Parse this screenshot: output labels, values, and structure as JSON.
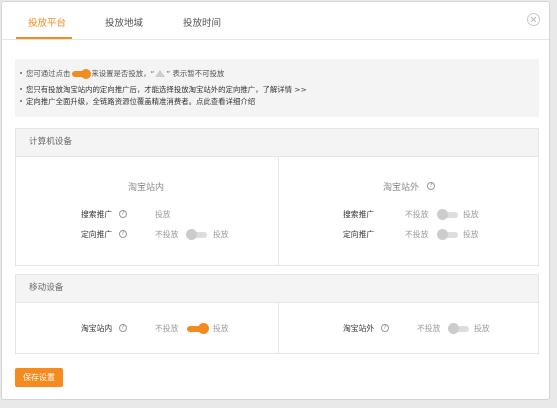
{
  "tabs": [
    {
      "label": "投放平台",
      "active": true
    },
    {
      "label": "投放地域",
      "active": false
    },
    {
      "label": "投放时间",
      "active": false
    }
  ],
  "notice": {
    "line1_prefix": "您可通过点击",
    "line1_mid": "来设置是否投放，“",
    "line1_suffix": "” 表示暂不可投放",
    "line2": "您只有投放淘宝站内的定向推广后，才能选择投放淘宝站外的定向推广，了解详情 >>",
    "line3": "定向推广全面升级，全链路资源位覆盖精准消费者。点此查看详细介绍"
  },
  "pc_section": {
    "title": "计算机设备",
    "inside": {
      "title": "淘宝站内",
      "rows": [
        {
          "label": "搜索推广",
          "state_on": "投放"
        },
        {
          "label": "定向推广",
          "state_off": "不投放",
          "state_on": "投放",
          "enabled": false
        }
      ]
    },
    "outside": {
      "title": "淘宝站外",
      "rows": [
        {
          "label": "搜索推广",
          "state_off": "不投放",
          "state_on": "投放",
          "enabled": false
        },
        {
          "label": "定向推广",
          "state_off": "不投放",
          "state_on": "投放",
          "enabled": false
        }
      ]
    }
  },
  "mobile_section": {
    "title": "移动设备",
    "inside": {
      "label": "淘宝站内",
      "state_off": "不投放",
      "state_on": "投放",
      "enabled": true
    },
    "outside": {
      "label": "淘宝站外",
      "state_off": "不投放",
      "state_on": "投放",
      "enabled": false
    }
  },
  "help_glyph": "?",
  "save_label": "保存设置",
  "colors": {
    "accent": "#f58a1f",
    "panel_bg": "#f4f4f4",
    "border": "#e6e6e6"
  },
  "icons": {
    "close": "close-icon",
    "help": "help-icon",
    "warning": "triangle-icon"
  }
}
